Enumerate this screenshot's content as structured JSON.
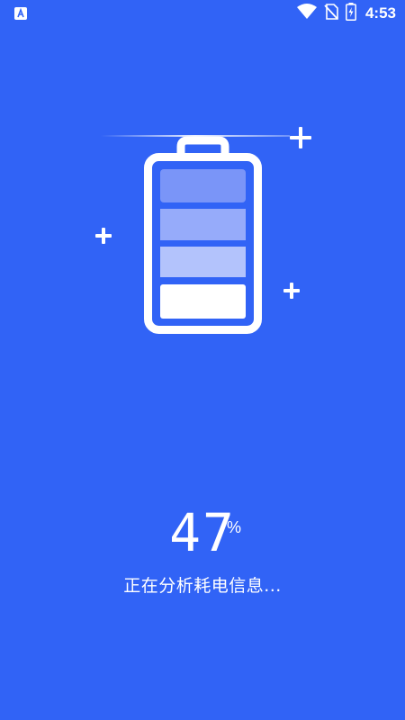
{
  "status_bar": {
    "time": "4:53",
    "icons": [
      "app-notification-icon",
      "wifi-icon",
      "no-sim-icon",
      "battery-charging-icon"
    ]
  },
  "battery": {
    "level_percent": 47,
    "filled_segments": 1,
    "total_segments": 4,
    "colors": {
      "background": "#3163F6",
      "segment_full": "#FFFFFF",
      "segment_light": "#B3C3FC",
      "segment_mid": "#96ABFA",
      "segment_dark": "#7A95F8"
    }
  },
  "main": {
    "percent_value": "47",
    "percent_unit": "%",
    "status_text": "正在分析耗电信息..."
  }
}
